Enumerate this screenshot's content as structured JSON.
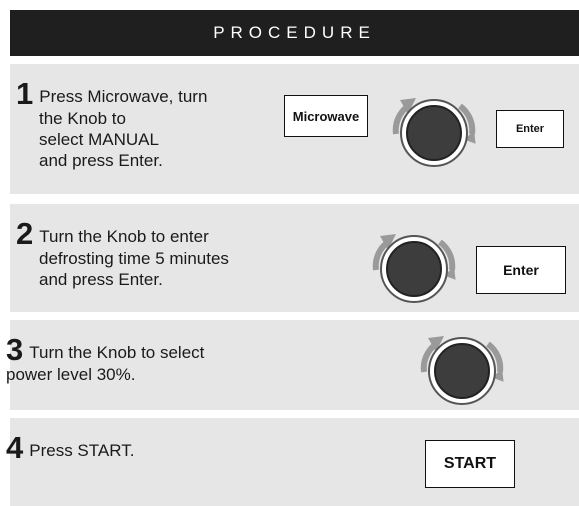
{
  "header": {
    "title": "PROCEDURE"
  },
  "steps": [
    {
      "number": "1",
      "text_first": "Press Microwave, turn",
      "text_rest": [
        "the Knob to",
        "select MANUAL",
        "and press Enter."
      ]
    },
    {
      "number": "2",
      "text_first": "Turn the Knob to enter",
      "text_rest": [
        "defrosting time 5 minutes",
        "and press Enter."
      ]
    },
    {
      "number": "3",
      "text_first": "Turn the Knob to select",
      "text_rest": [
        "power level 30%."
      ]
    },
    {
      "number": "4",
      "text_first": "Press START.",
      "text_rest": []
    }
  ],
  "buttons": {
    "microwave": "Microwave",
    "enter": "Enter",
    "start": "START"
  },
  "icons": {
    "knob": "rotary-knob-icon",
    "rotate_left": "rotate-left-arrow-icon",
    "rotate_right": "rotate-right-arrow-icon"
  },
  "colors": {
    "header_bg": "#1f1f1f",
    "step_bg": "#e6e6e6",
    "knob_dark": "#3d3d3d",
    "arrow_gray": "#9a9a9a"
  }
}
